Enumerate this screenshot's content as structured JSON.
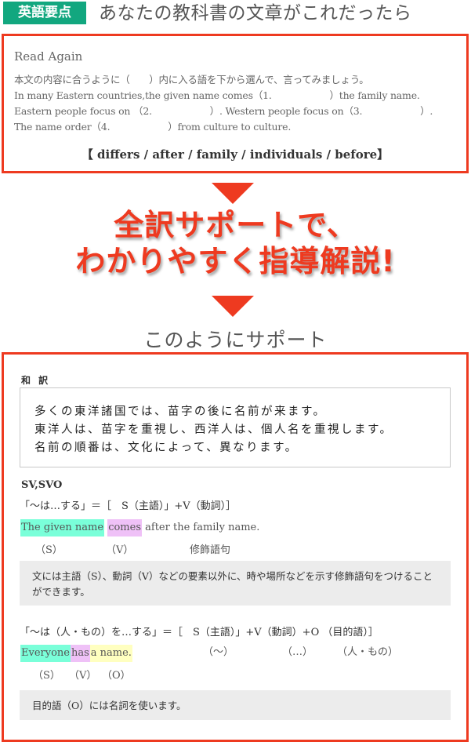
{
  "header": {
    "badge": "英語要点",
    "title": "あなたの教科書の文章がこれだったら"
  },
  "read_again": {
    "title": "Read Again",
    "instruction": "本文の内容に合うように（　　）内に入る語を下から選んで、言ってみましょう。",
    "line1": "In many Eastern countries,the given name comes（1.　　　　　　）the family name.",
    "line2": "Eastern people focus on （2.　　　　　　）. Western people focus on（3.　　　　　　）.",
    "line3": "The name order（4.　　　　　　）from culture to culture.",
    "choices": "【 differs / after / family / individuals / before】"
  },
  "promo": {
    "line1": "全訳サポートで、",
    "line2": "わかりやすく指導解説!"
  },
  "support": {
    "title": "このようにサポート",
    "wayaku_label": "和 訳",
    "translation": [
      "多くの東洋諸国では、苗字の後に名前が来ます。",
      "東洋人は、苗字を重視し、西洋人は、個人名を重視します。",
      "名前の順番は、文化によって、異なります。"
    ],
    "sv": {
      "heading": "SV,SVO",
      "formula": "「～は…する」＝［　S（主語）」+V（動詞）］",
      "subject": "The given name",
      "verb": "comes",
      "rest": "after the family name.",
      "tag_s": "（S）",
      "tag_v": "（V）",
      "tag_mod": "修飾語句",
      "note": "文には主語（S）、動詞（V）などの要素以外に、時や場所などを示す修飾語句をつけることができます。"
    },
    "svo": {
      "formula": "「～は（人・もの）を…する」＝［　S（主語）」+V（動詞）+O （目的語）］",
      "gloss_s": "（～）",
      "gloss_v": "（…）",
      "gloss_o": "（人・もの）",
      "subject": "Everyone",
      "verb": "has",
      "object": "a name.",
      "tag_s": "（S）",
      "tag_v": "（V）",
      "tag_o": "（O）",
      "note": "目的語（O）には名詞を使います。"
    }
  },
  "colors": {
    "accent_red": "#ee3a20",
    "badge_green": "#12a77f",
    "highlight_subject": "#7affd9",
    "highlight_verb": "#efc1f7",
    "highlight_object": "#ffffc0",
    "note_bg": "#ececec"
  }
}
